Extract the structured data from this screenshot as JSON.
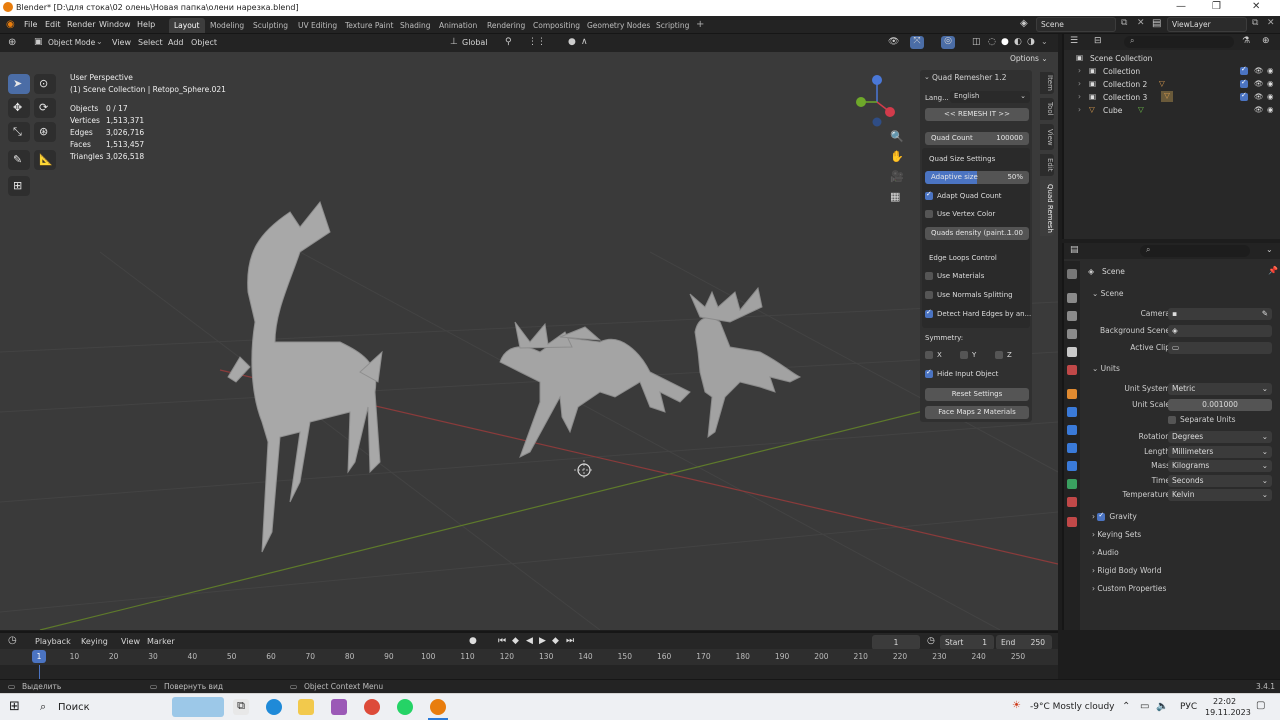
{
  "window": {
    "title": "Blender* [D:\\для стока\\02 олень\\Новая папка\\олени нарезка.blend]"
  },
  "menus": [
    "File",
    "Edit",
    "Render",
    "Window",
    "Help"
  ],
  "workspaces": [
    "Layout",
    "Modeling",
    "Sculpting",
    "UV Editing",
    "Texture Paint",
    "Shading",
    "Animation",
    "Rendering",
    "Compositing",
    "Geometry Nodes",
    "Scripting"
  ],
  "active_workspace": "Layout",
  "scene_field": "Scene",
  "viewlayer_field": "ViewLayer",
  "viewport_header": {
    "mode": "Object Mode",
    "view": "View",
    "select": "Select",
    "add": "Add",
    "object": "Object",
    "orientation": "Global",
    "options": "Options"
  },
  "overlay": {
    "view_name": "User Perspective",
    "collection": "(1) Scene Collection | Retopo_Sphere.021",
    "stats": [
      {
        "label": "Objects",
        "value": "0 / 17"
      },
      {
        "label": "Vertices",
        "value": "1,513,371"
      },
      {
        "label": "Edges",
        "value": "3,026,716"
      },
      {
        "label": "Faces",
        "value": "1,513,457"
      },
      {
        "label": "Triangles",
        "value": "3,026,518"
      }
    ]
  },
  "quad_remesher": {
    "title": "Quad Remesher 1.2",
    "lang_label": "Lang...",
    "lang_value": "English",
    "remesh_button": "<< REMESH IT >>",
    "quad_count_label": "Quad Count",
    "quad_count_value": "100000",
    "quad_size_settings": "Quad Size Settings",
    "adaptive_size_label": "Adaptive size",
    "adaptive_size_value": "50%",
    "adaptive_size_fraction": 0.5,
    "adapt_quad_count": "Adapt Quad Count",
    "use_vertex_color": "Use Vertex Color",
    "quads_density": "Quads density (paint...",
    "quads_density_value": "1.00",
    "edge_loops_control": "Edge Loops Control",
    "use_materials": "Use Materials",
    "use_normals_splitting": "Use Normals Splitting",
    "detect_hard_edges": "Detect Hard Edges by an...",
    "symmetry": "Symmetry:",
    "sym_x": "X",
    "sym_y": "Y",
    "sym_z": "Z",
    "hide_input_object": "Hide Input Object",
    "reset_settings": "Reset Settings",
    "face_maps": "Face Maps 2 Materials"
  },
  "sidebar_tabs": [
    "Item",
    "Tool",
    "View",
    "Edit",
    "Quad Remesh"
  ],
  "outliner": {
    "root": "Scene Collection",
    "items": [
      "Collection",
      "Collection 2",
      "Collection 3",
      "Cube"
    ]
  },
  "properties": {
    "context": "Scene",
    "scene_panel": "Scene",
    "camera_label": "Camera",
    "background_scene_label": "Background Scene",
    "active_clip_label": "Active Clip",
    "units_panel": "Units",
    "unit_system_label": "Unit System",
    "unit_system_value": "Metric",
    "unit_scale_label": "Unit Scale",
    "unit_scale_value": "0.001000",
    "separate_units": "Separate Units",
    "rotation_label": "Rotation",
    "rotation_value": "Degrees",
    "length_label": "Length",
    "length_value": "Millimeters",
    "mass_label": "Mass",
    "mass_value": "Kilograms",
    "time_label": "Time",
    "time_value": "Seconds",
    "temperature_label": "Temperature",
    "temperature_value": "Kelvin",
    "collapsed_panels": [
      "Gravity",
      "Keying Sets",
      "Audio",
      "Rigid Body World",
      "Custom Properties"
    ]
  },
  "timeline": {
    "playback": "Playback",
    "keying": "Keying",
    "view": "View",
    "marker": "Marker",
    "current_frame": "1",
    "start_label": "Start",
    "start_value": "1",
    "end_label": "End",
    "end_value": "250",
    "ticks": [
      "1",
      "10",
      "20",
      "30",
      "40",
      "50",
      "60",
      "70",
      "80",
      "90",
      "100",
      "110",
      "120",
      "130",
      "140",
      "150",
      "160",
      "170",
      "180",
      "190",
      "200",
      "210",
      "220",
      "230",
      "240",
      "250"
    ]
  },
  "statusbar": {
    "select": "Выделить",
    "rotate": "Повернуть вид",
    "context_menu": "Object Context Menu",
    "version": "3.4.1"
  },
  "taskbar": {
    "search": "Поиск",
    "weather": "-9°C  Mostly cloudy",
    "lang": "РУС",
    "time": "22:02",
    "date": "19.11.2023"
  }
}
